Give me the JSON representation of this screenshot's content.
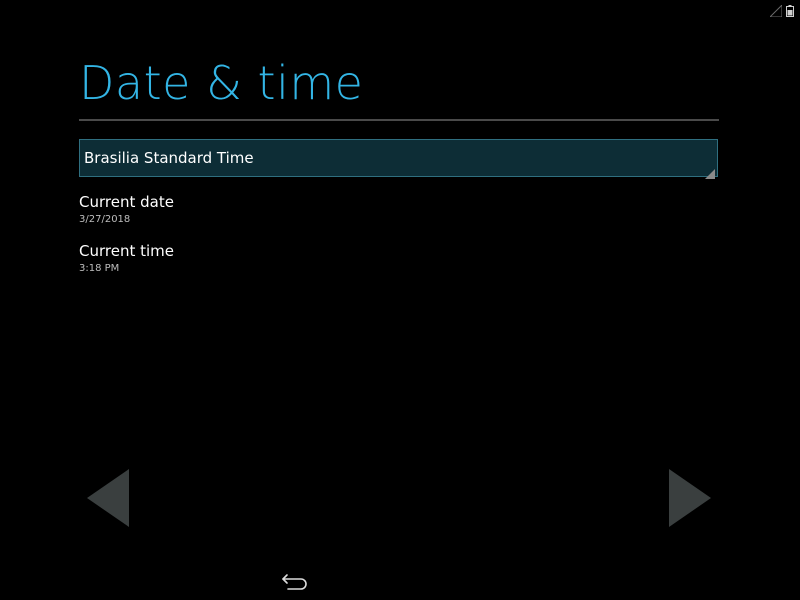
{
  "page_title": "Date & time",
  "timezone": {
    "selected": "Brasilia Standard Time"
  },
  "settings": [
    {
      "title": "Current date",
      "summary": "3/27/2018"
    },
    {
      "title": "Current time",
      "summary": "3:18 PM"
    }
  ],
  "colors": {
    "accent": "#33b5e5",
    "background": "#000000",
    "spinner_bg": "#0d2d36",
    "spinner_border": "#2f6f80",
    "nav_arrow": "#3a3f3f"
  },
  "icons": {
    "status": [
      "signal-icon",
      "battery-icon"
    ],
    "nav_left": "previous-arrow-icon",
    "nav_right": "next-arrow-icon",
    "back": "back-icon"
  }
}
